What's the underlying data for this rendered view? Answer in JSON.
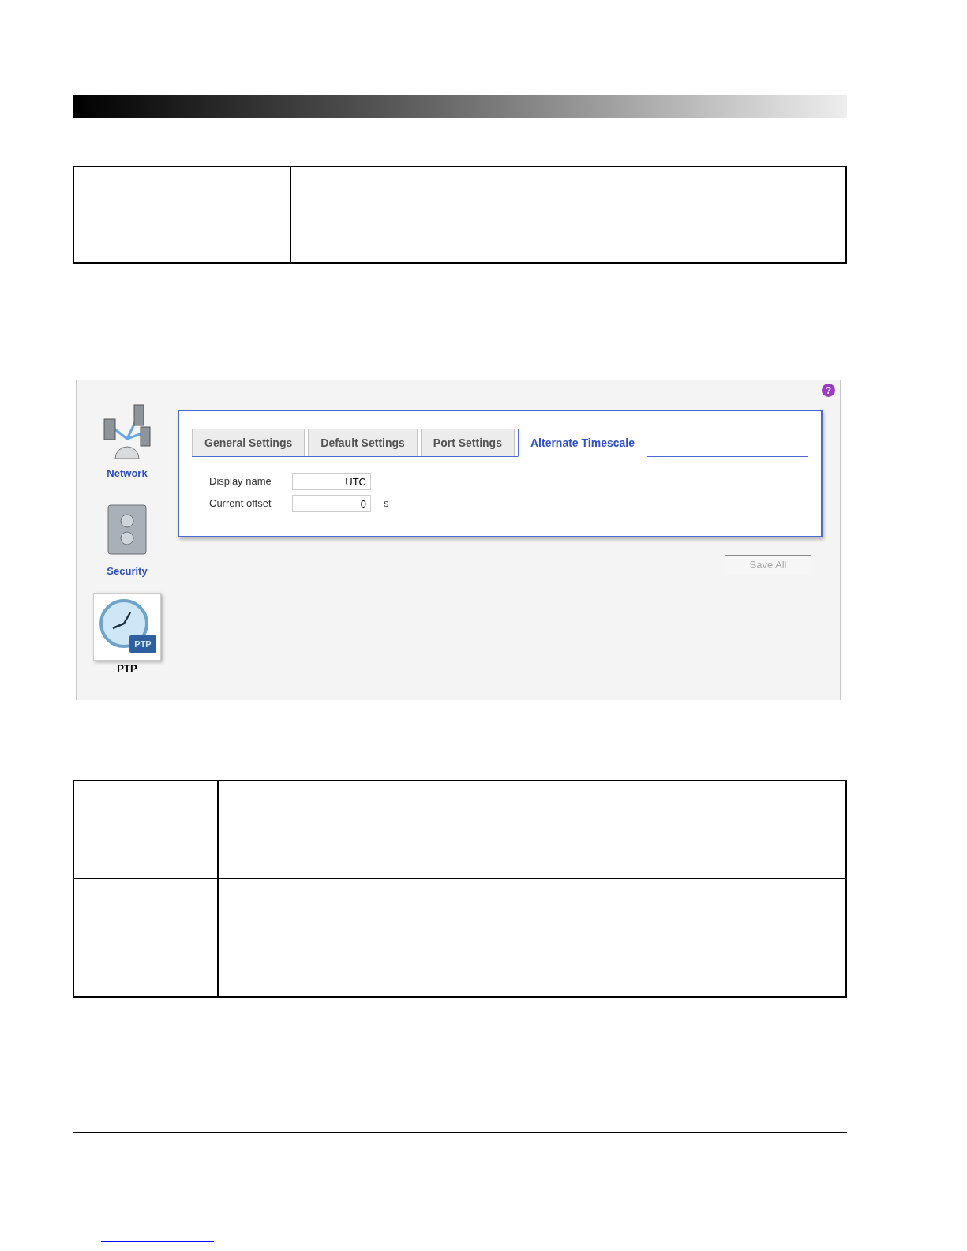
{
  "app": {
    "help": "?",
    "sidebar": [
      {
        "kind": "network",
        "label": "Network",
        "selected": false
      },
      {
        "kind": "security",
        "label": "Security",
        "selected": false
      },
      {
        "kind": "ptp",
        "label": "PTP",
        "badge": "PTP",
        "selected": true
      }
    ],
    "tabs": [
      {
        "label": "General Settings",
        "selected": false
      },
      {
        "label": "Default Settings",
        "selected": false
      },
      {
        "label": "Port Settings",
        "selected": false
      },
      {
        "label": "Alternate Timescale",
        "selected": true
      }
    ],
    "fields": [
      {
        "label": "Display name",
        "value": "UTC"
      },
      {
        "label": "Current offset",
        "value": "0",
        "unit": "s"
      }
    ],
    "save_button": {
      "label": "Save All",
      "disabled": true
    }
  }
}
